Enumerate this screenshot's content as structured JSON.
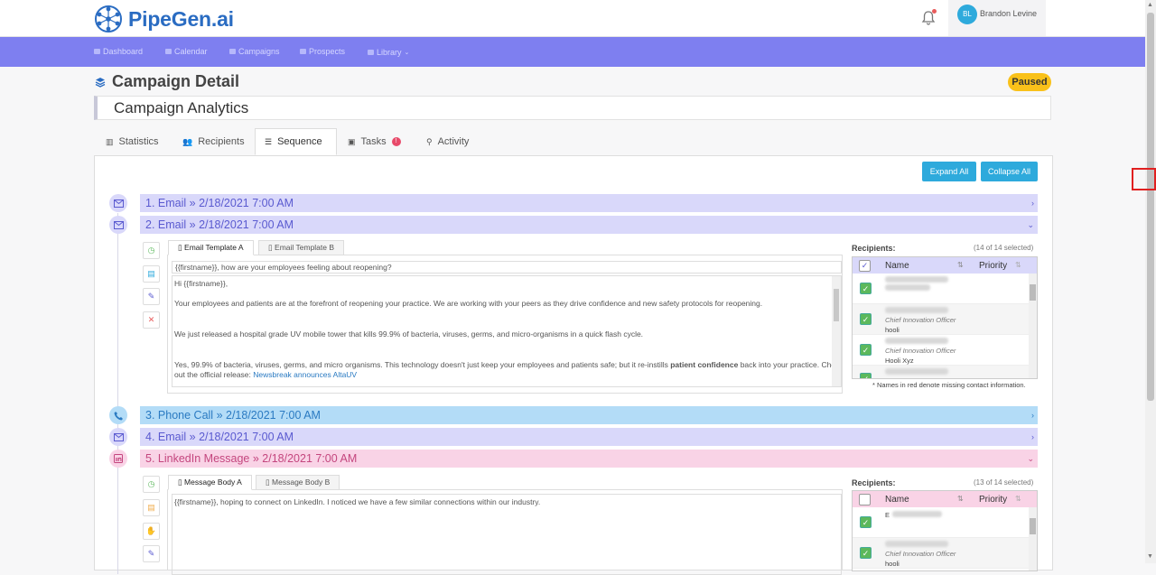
{
  "app": {
    "name": "PipeGen.ai"
  },
  "user": {
    "initials": "BL",
    "name": "Brandon Levine"
  },
  "nav": [
    {
      "label": "Dashboard",
      "icon": "monitor-icon"
    },
    {
      "label": "Calendar",
      "icon": "calendar-icon"
    },
    {
      "label": "Campaigns",
      "icon": "layers-icon"
    },
    {
      "label": "Prospects",
      "icon": "users-icon"
    },
    {
      "label": "Library",
      "icon": "stack-icon"
    }
  ],
  "page": {
    "title": "Campaign Detail",
    "status": "Paused",
    "campaign_name": "Campaign Analytics"
  },
  "tabs": [
    {
      "label": "Statistics",
      "icon": "chart-icon"
    },
    {
      "label": "Recipients",
      "icon": "users-icon"
    },
    {
      "label": "Sequence",
      "icon": "list-icon",
      "active": true
    },
    {
      "label": "Tasks",
      "icon": "calendar-check-icon",
      "badge": "!"
    },
    {
      "label": "Activity",
      "icon": "activity-icon"
    }
  ],
  "actions": {
    "expand": "Expand All",
    "collapse": "Collapse All"
  },
  "steps": [
    {
      "num": "1.",
      "type": "Email",
      "sep": "»",
      "date": "2/18/2021 7:00 AM",
      "color": "#d9d8fa",
      "text_color": "#5a5ad0"
    },
    {
      "num": "2.",
      "type": "Email",
      "sep": "»",
      "date": "2/18/2021 7:00 AM",
      "color": "#d9d8fa",
      "text_color": "#5a5ad0"
    },
    {
      "num": "3.",
      "type": "Phone Call",
      "sep": "»",
      "date": "2/18/2021 7:00 AM",
      "color": "#b3dcf7",
      "text_color": "#2a7ac2"
    },
    {
      "num": "4.",
      "type": "Email",
      "sep": "»",
      "date": "2/18/2021 7:00 AM",
      "color": "#d9d8fa",
      "text_color": "#5a5ad0"
    },
    {
      "num": "5.",
      "type": "LinkedIn Message",
      "sep": "»",
      "date": "2/18/2021 7:00 AM",
      "color": "#f9d3e6",
      "text_color": "#c4467e"
    }
  ],
  "email": {
    "tabs": [
      "Email Template A",
      "Email Template B"
    ],
    "subject": "{{firstname}}, how are your employees feeling about reopening?",
    "lines": [
      "Hi {{firstname}},",
      "Your employees and patients are at the forefront of reopening your practice. We are working with your peers as they drive confidence and new safety protocols for reopening.",
      "We just released a hospital grade UV mobile tower that kills 99.9% of bacteria, viruses, germs, and micro-organisms in a quick flash cycle.",
      "Yes, 99.9% of bacteria, viruses, germs, and micro organisms. This technology doesn't just keep your employees and patients safe; but it re-instills",
      "patient confidence",
      "back into your practice. Check",
      "out the official release:",
      "Newsbreak announces AltaUV"
    ]
  },
  "linkedin": {
    "tabs": [
      "Message Body A",
      "Message Body B"
    ],
    "line": "{{firstname}}, hoping to connect on LinkedIn. I noticed we have a few similar connections within our industry."
  },
  "recipients": {
    "label": "Recipients:",
    "count_email": "(14 of 14 selected)",
    "count_linkedin": "(13 of 14 selected)",
    "col_name": "Name",
    "col_priority": "Priority",
    "rows": [
      {
        "title": "",
        "company": ""
      },
      {
        "title": "Chief Innovation Officer",
        "company": "hooli"
      },
      {
        "title": "Chief Innovation Officer",
        "company": "Hooli Xyz"
      }
    ],
    "rows_linkedin": [
      {
        "title": "",
        "company": "E"
      },
      {
        "title": "Chief Innovation Officer",
        "company": "hooli"
      }
    ],
    "note": "* Names in red denote missing contact information."
  }
}
